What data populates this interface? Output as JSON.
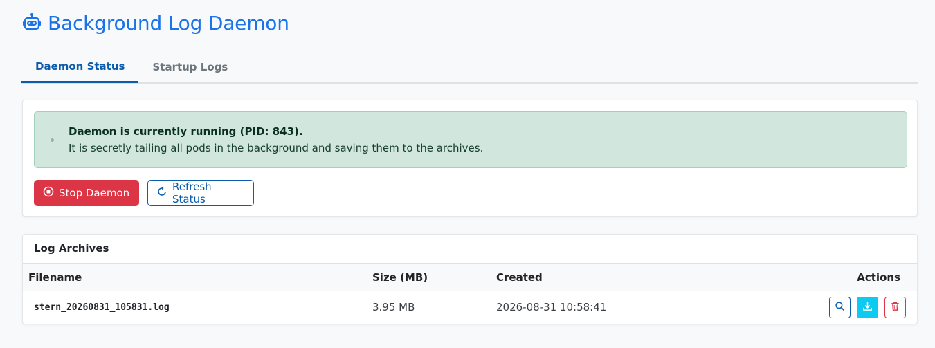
{
  "header": {
    "title": "Background Log Daemon",
    "icon": "robot-icon",
    "accent_color": "#1a73e8"
  },
  "tabs": [
    {
      "label": "Daemon Status",
      "active": true
    },
    {
      "label": "Startup Logs",
      "active": false
    }
  ],
  "status": {
    "heading": "Daemon is currently running (PID: 843).",
    "description": "It is secretly tailing all pods in the background and saving them to the archives.",
    "alert_color": "#d1e7dd",
    "stop_label": "Stop Daemon",
    "refresh_label": "Refresh Status"
  },
  "archives": {
    "title": "Log Archives",
    "columns": [
      "Filename",
      "Size (MB)",
      "Created",
      "Actions"
    ],
    "rows": [
      {
        "filename": "stern_20260831_105831.log",
        "size": "3.95 MB",
        "created": "2026-08-31 10:58:41"
      }
    ]
  },
  "colors": {
    "danger": "#dc3545",
    "primary": "#0b5cad",
    "info": "#0dcaf0"
  }
}
